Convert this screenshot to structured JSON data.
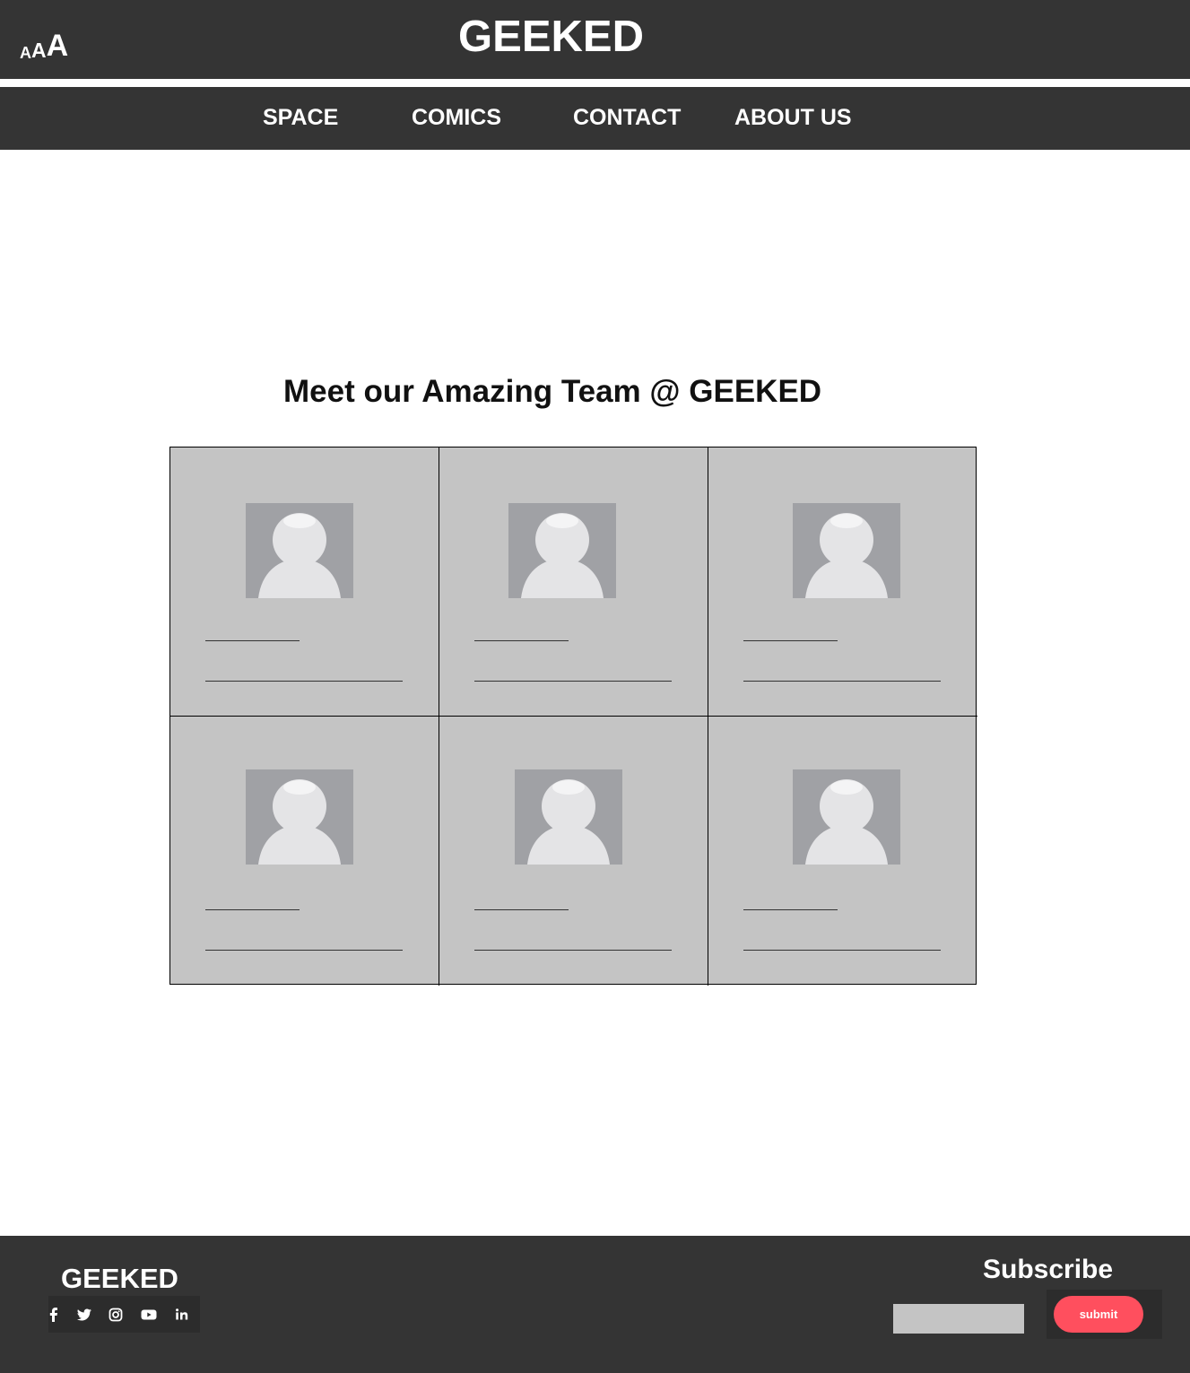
{
  "header": {
    "font_size_control": {
      "small": "A",
      "medium": "A",
      "large": "A"
    },
    "title": "GEEKED"
  },
  "nav": {
    "items": [
      {
        "label": "SPACE"
      },
      {
        "label": "COMICS"
      },
      {
        "label": "CONTACT"
      },
      {
        "label": "ABOUT US"
      }
    ]
  },
  "main": {
    "heading": "Meet our Amazing Team @ GEEKED",
    "team_cards": [
      {
        "avatar_icon": "user-placeholder-icon"
      },
      {
        "avatar_icon": "user-placeholder-icon"
      },
      {
        "avatar_icon": "user-placeholder-icon"
      },
      {
        "avatar_icon": "user-placeholder-icon"
      },
      {
        "avatar_icon": "user-placeholder-icon"
      },
      {
        "avatar_icon": "user-placeholder-icon"
      }
    ]
  },
  "footer": {
    "brand": "GEEKED",
    "social_icons": [
      "facebook-icon",
      "twitter-icon",
      "instagram-icon",
      "youtube-icon",
      "linkedin-icon"
    ],
    "subscribe": {
      "title": "Subscribe",
      "input_value": "",
      "submit_label": "submit"
    }
  },
  "colors": {
    "bar_background": "#343434",
    "card_background": "#c4c4c4",
    "avatar_background": "#a0a1a5",
    "submit_accent": "#ff4f5e"
  }
}
